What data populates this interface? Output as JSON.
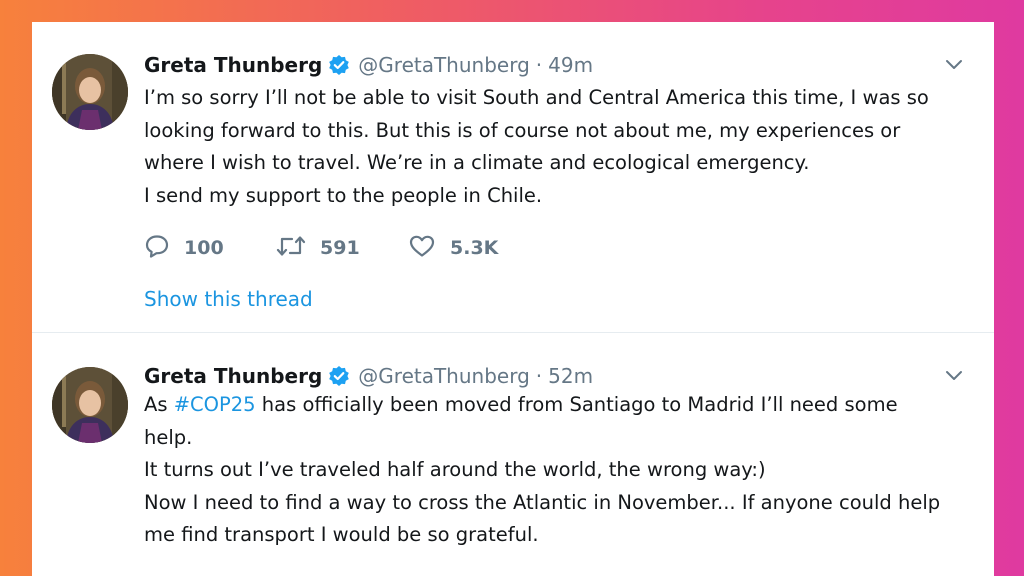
{
  "colors": {
    "link": "#1b95e0",
    "muted": "#657786",
    "text": "#14171a",
    "verified": "#1da1f2"
  },
  "tweets": [
    {
      "author_name": "Greta Thunberg",
      "handle": "@GretaThunberg",
      "separator": "·",
      "time": "49m",
      "lines": [
        "I’m so sorry I’ll not be able to visit South and Central America this time, I was so",
        "looking forward to this. But this is of course not about me, my experiences or",
        "where I wish to travel. We’re in a climate and ecological emergency.",
        "I send my support to the people in Chile."
      ],
      "replies": "100",
      "retweets": "591",
      "likes": "5.3K",
      "show_thread": "Show this thread"
    },
    {
      "author_name": "Greta Thunberg",
      "handle": "@GretaThunberg",
      "separator": "·",
      "time": "52m",
      "first_line": {
        "prefix": "As ",
        "hashtag": "#COP25",
        "suffix": " has officially been moved from Santiago to Madrid I’ll need some"
      },
      "lines": [
        "help.",
        "It turns out I’ve traveled half around the world, the wrong way:)",
        "Now I need to find a way to cross the Atlantic in November... If anyone could help",
        "me find transport I would be so grateful."
      ]
    }
  ]
}
